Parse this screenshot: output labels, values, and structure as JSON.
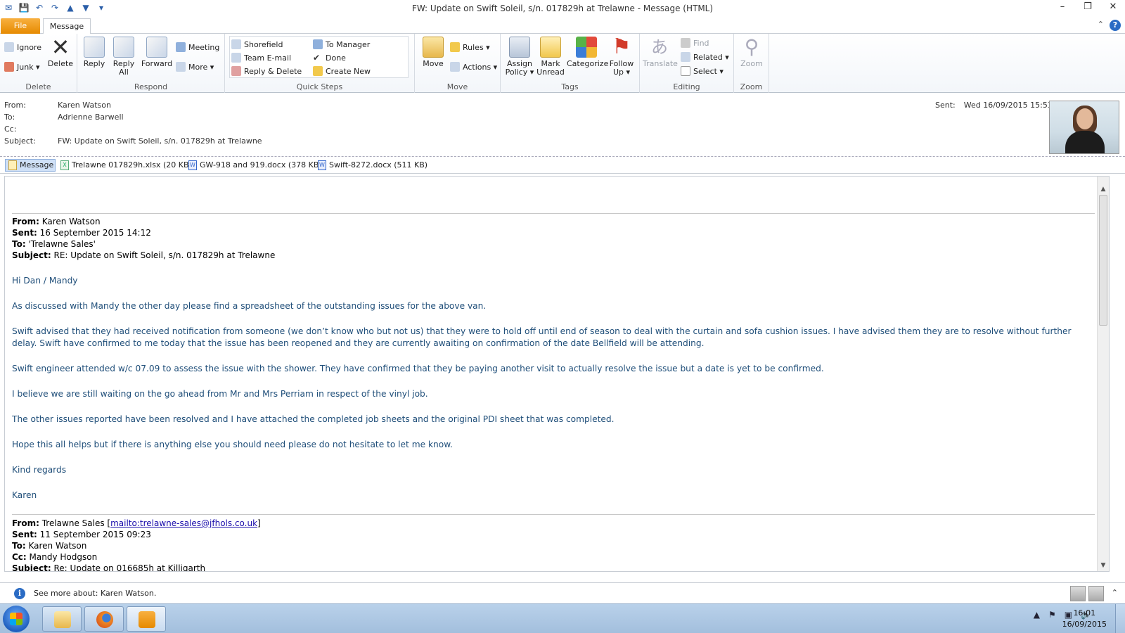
{
  "window": {
    "title": "FW: Update on Swift Soleil, s/n. 017829h at Trelawne  - Message (HTML)",
    "minimize": "–",
    "restore": "❐",
    "close": "✕"
  },
  "qat": {
    "outlook": "✉",
    "save": "💾",
    "undo": "↶",
    "redo": "↷",
    "up": "▲",
    "down": "▼",
    "customize": "▾"
  },
  "tabs": {
    "file": "File",
    "message": "Message",
    "help": "?",
    "collapse": "⌃"
  },
  "ribbon": {
    "delete_group": {
      "label": "Delete",
      "ignore": "Ignore",
      "junk": "Junk ▾",
      "delete": "Delete"
    },
    "respond_group": {
      "label": "Respond",
      "reply": "Reply",
      "reply_all_1": "Reply",
      "reply_all_2": "All",
      "forward": "Forward",
      "meeting": "Meeting",
      "more": "More ▾"
    },
    "quick_steps": {
      "label": "Quick Steps",
      "shorefield": "Shorefield",
      "team_email": "Team E-mail",
      "reply_delete": "Reply & Delete",
      "to_manager": "To Manager",
      "done": "Done",
      "create_new": "Create New"
    },
    "move_group": {
      "label": "Move",
      "move": "Move",
      "rules": "Rules ▾",
      "actions": "Actions ▾"
    },
    "tags_group": {
      "label": "Tags",
      "assign_1": "Assign",
      "assign_2": "Policy ▾",
      "mark_1": "Mark",
      "mark_2": "Unread",
      "categorize": "Categorize",
      "follow_1": "Follow",
      "follow_2": "Up ▾"
    },
    "editing_group": {
      "label": "Editing",
      "translate": "Translate",
      "find": "Find",
      "related": "Related ▾",
      "select": "Select ▾"
    },
    "zoom_group": {
      "label": "Zoom",
      "zoom": "Zoom"
    }
  },
  "header": {
    "from_label": "From:",
    "from": "Karen Watson",
    "to_label": "To:",
    "to": "Adrienne Barwell",
    "cc_label": "Cc:",
    "cc": "",
    "subject_label": "Subject:",
    "subject": "FW: Update on Swift Soleil, s/n. 017829h at Trelawne",
    "sent_label": "Sent:",
    "sent": "Wed 16/09/2015 15:53"
  },
  "attachments": {
    "message": "Message",
    "items": [
      {
        "name": "Trelawne 017829h.xlsx (20 KB)",
        "type": "X"
      },
      {
        "name": "GW-918 and 919.docx (378 KB)",
        "type": "W"
      },
      {
        "name": "Swift-8272.docx (511 KB)",
        "type": "W"
      }
    ]
  },
  "body": {
    "h1": {
      "from_label": "From:",
      "from": " Karen Watson",
      "sent_label": "Sent:",
      "sent": " 16 September 2015 14:12",
      "to_label": "To:",
      "to": " 'Trelawne Sales'",
      "subject_label": "Subject:",
      "subject": " RE: Update on Swift Soleil, s/n. 017829h at Trelawne"
    },
    "paragraphs": [
      "Hi Dan / Mandy",
      "As discussed with Mandy the other day please find a spreadsheet of the outstanding issues for the above van.",
      "Swift advised that they had received notification from someone (we don’t know who but not us) that they were to hold off until end of season to deal with the curtain and sofa cushion issues. I have advised them they are to resolve without further delay. Swift have confirmed to me today that the issue has been reopened and they are currently awaiting on confirmation of the date Bellfield will be attending.",
      "Swift engineer attended w/c 07.09 to assess the issue with the shower. They have confirmed that they be paying another visit to actually resolve the issue but a date is yet to be confirmed.",
      "I believe we are still waiting on the go ahead from Mr and Mrs Perriam in respect of the vinyl job.",
      "The other issues reported have been resolved and I have attached the completed job sheets and the original PDI sheet that was completed.",
      "Hope this all helps but if there is anything else you should need please do not hesitate to let me know.",
      "Kind regards",
      "Karen"
    ],
    "h2": {
      "from_label": "From:",
      "from": " Trelawne Sales ",
      "mailto": "mailto:trelawne-sales@jfhols.co.uk",
      "sent_label": "Sent:",
      "sent": " 11 September 2015 09:23",
      "to_label": "To:",
      "to": " Karen Watson",
      "cc_label": "Cc:",
      "cc": " Mandy Hodgson",
      "subject_label": "Subject:",
      "subject": " Re: Update on 016685h at Killigarth"
    }
  },
  "people_pane": {
    "text": "See more about: Karen Watson.",
    "info": "i",
    "chevron": "⌃"
  },
  "taskbar": {
    "time": "16:01",
    "date": "16/09/2015",
    "tray": [
      "▲",
      "⚑",
      "▣",
      "🔊"
    ]
  }
}
